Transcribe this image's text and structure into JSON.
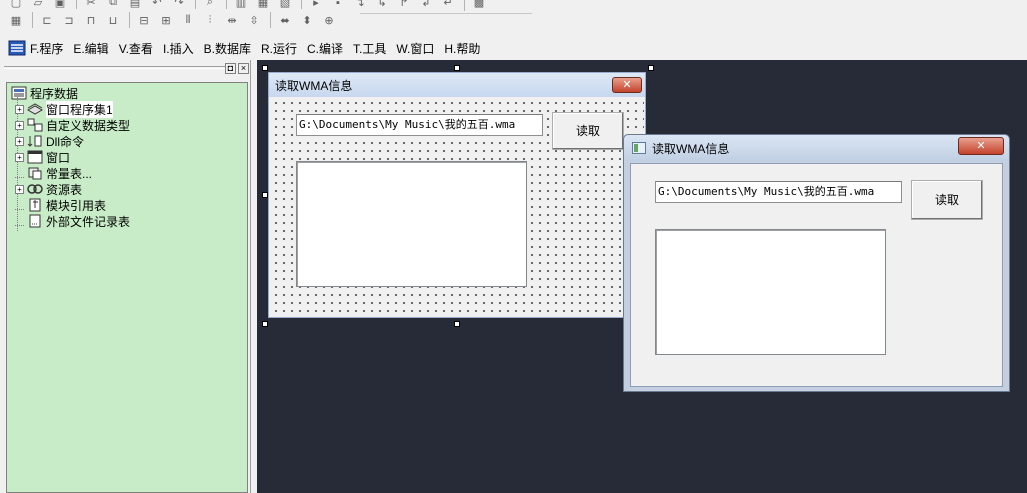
{
  "menu": {
    "items": [
      "F.程序",
      "E.编辑",
      "V.查看",
      "I.插入",
      "B.数据库",
      "R.运行",
      "C.编译",
      "T.工具",
      "W.窗口",
      "H.帮助"
    ]
  },
  "toolbar": {
    "top_icons": [
      "file-icon",
      "open-icon",
      "save-icon",
      "cut-icon",
      "copy-icon",
      "paste-icon",
      "undo-icon",
      "redo-icon",
      "find-icon",
      "layout-icon",
      "layout-icon",
      "layout-icon",
      "run-icon",
      "stop-icon",
      "step-icon",
      "step-icon",
      "step-icon",
      "step-icon",
      "step-icon",
      "build-icon"
    ],
    "align_icons": [
      "form-icon",
      "align-left-icon",
      "align-right-icon",
      "align-top-icon",
      "align-bottom-icon",
      "center-h-icon",
      "center-v-icon",
      "space-h-icon",
      "space-v-icon",
      "spread-h-icon",
      "spread-v-icon",
      "same-width-icon",
      "same-height-icon",
      "same-size-icon"
    ]
  },
  "panel": {
    "pin_label": "◘",
    "close_label": "×",
    "tree": {
      "root": "程序数据",
      "items": [
        {
          "label": "窗口程序集1",
          "icon": "assembly-icon",
          "expandable": true
        },
        {
          "label": "自定义数据类型",
          "icon": "datatype-icon",
          "expandable": true
        },
        {
          "label": "Dll命令",
          "icon": "dll-icon",
          "expandable": true
        },
        {
          "label": "窗口",
          "icon": "window-icon",
          "expandable": true
        },
        {
          "label": "常量表...",
          "icon": "constant-icon",
          "expandable": false
        },
        {
          "label": "资源表",
          "icon": "resource-icon",
          "expandable": true
        },
        {
          "label": "模块引用表",
          "icon": "module-icon",
          "expandable": false
        },
        {
          "label": "外部文件记录表",
          "icon": "file-record-icon",
          "expandable": false
        }
      ]
    }
  },
  "design_form": {
    "title": "读取WMA信息",
    "path_value": "G:\\Documents\\My Music\\我的五百.wma",
    "read_button": "读取",
    "close_label": "✕"
  },
  "run_window": {
    "title": "读取WMA信息",
    "path_value": "G:\\Documents\\My Music\\我的五百.wma",
    "read_button": "读取",
    "close_label": "✕"
  }
}
